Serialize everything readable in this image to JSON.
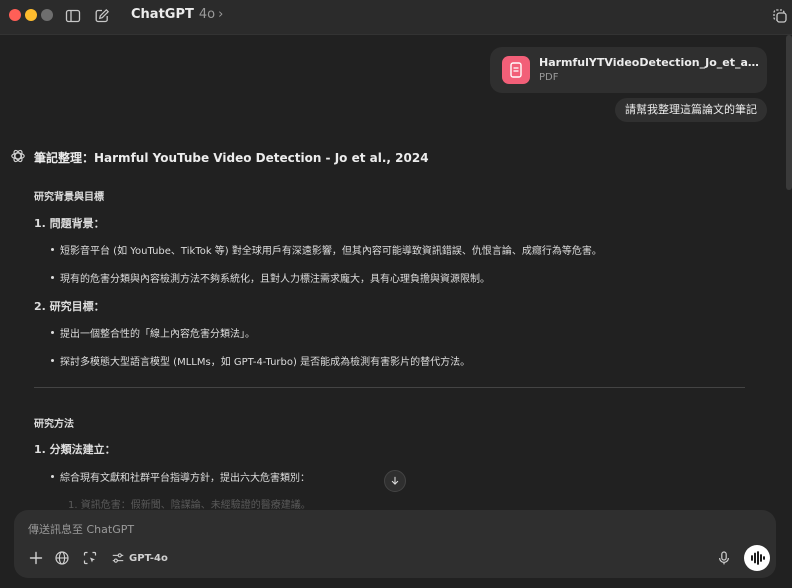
{
  "titlebar": {
    "app_name": "ChatGPT",
    "model": "4o",
    "model_chevron": "›"
  },
  "conversation": {
    "attachment": {
      "file_name": "HarmfulYTVideoDetection_Jo_et_al_202...",
      "file_type": "PDF",
      "icon_color": "#f25f78"
    },
    "user_message": "請幫我整理這篇論文的筆記",
    "response": {
      "heading": "筆記整理：Harmful YouTube Video Detection - Jo et al., 2024",
      "section1": {
        "title": "研究背景與目標",
        "item1": {
          "label": "1.  問題背景：",
          "bullets": [
            "短影音平台 (如 YouTube、TikTok 等) 對全球用戶有深遠影響，但其內容可能導致資訊錯誤、仇恨言論、成癮行為等危害。",
            "現有的危害分類與內容檢測方法不夠系統化，且對人力標注需求龐大，具有心理負擔與資源限制。"
          ]
        },
        "item2": {
          "label": "2.  研究目標：",
          "bullets": [
            "提出一個整合性的「線上內容危害分類法」。",
            "探討多模態大型語言模型 (MLLMs，如 GPT-4-Turbo) 是否能成為檢測有害影片的替代方法。"
          ]
        }
      },
      "section2": {
        "title": "研究方法",
        "item1": {
          "label": "1.  分類法建立：",
          "bullets": [
            "綜合現有文獻和社群平台指導方針，提出六大危害類別："
          ],
          "sub_item": "1.  資訊危害：假新聞、陰謀論、未經驗證的醫療建議。"
        }
      }
    }
  },
  "composer": {
    "placeholder": "傳送訊息至 ChatGPT",
    "model_label": "GPT-4o",
    "voice_color": "#ffffff"
  }
}
